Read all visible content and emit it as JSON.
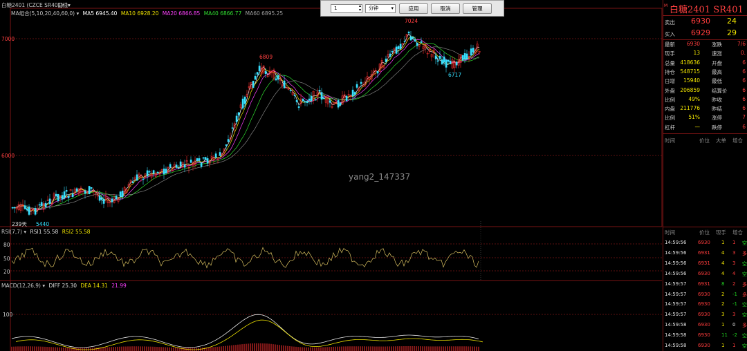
{
  "header": {
    "symbol_title": "白糖2401 (CZCE SR401)",
    "period": "日线",
    "ma_label": "MA组合(5,10,20,40,60,0)",
    "ma5": "MA5 6945.40",
    "ma10": "MA10 6928.20",
    "ma20": "MA20 6866.85",
    "ma40": "MA40 6866.77",
    "ma60": "MA60 6895.25"
  },
  "toolbar": {
    "count_value": "1",
    "unit_value": "分钟",
    "apply_label": "应用",
    "cancel_label": "取消",
    "manage_label": "管理"
  },
  "price_axis": {
    "p7000": "7000",
    "p6000": "6000"
  },
  "annotations": {
    "high_label": "7024",
    "peak_label": "6809",
    "low_label": "5440",
    "dip_label": "6717",
    "bottom_tag": "239天"
  },
  "watermark": "yang2_147337",
  "rsi": {
    "label": "RSI(7,7)",
    "rsi1": "RSI1 55.58",
    "rsi2": "RSI2 55.58",
    "ticks": [
      "80",
      "50",
      "20"
    ]
  },
  "macd": {
    "label": "MACD(12,26,9)",
    "diff": "DIFF 25.30",
    "dea": "DEA 14.31",
    "macd": "21.99",
    "tick": "100"
  },
  "quote": {
    "title": "白糖2401",
    "code": "SR401",
    "sell_label": "卖出",
    "sell_price": "6930",
    "sell_vol": "24",
    "buy_label": "买入",
    "buy_price": "6929",
    "buy_vol": "29",
    "rows": [
      {
        "l1": "最新",
        "v1": "6930",
        "c1": "red",
        "l2": "涨跌",
        "v2": "7/6"
      },
      {
        "l1": "现手",
        "v1": "13",
        "c1": "yel",
        "l2": "速涨",
        "v2": "0."
      },
      {
        "l1": "总量",
        "v1": "418636",
        "c1": "yel",
        "l2": "开盘",
        "v2": "6"
      },
      {
        "l1": "持仓",
        "v1": "548715",
        "c1": "yel",
        "l2": "最高",
        "v2": "6"
      },
      {
        "l1": "日增",
        "v1": "15940",
        "c1": "yel",
        "l2": "最低",
        "v2": "6"
      },
      {
        "l1": "外盘",
        "v1": "206859",
        "c1": "yel",
        "l2": "结算价",
        "v2": "6"
      },
      {
        "l1": "比例",
        "v1": "49%",
        "c1": "yel",
        "l2": "昨收",
        "v2": "6"
      },
      {
        "l1": "内盘",
        "v1": "211776",
        "c1": "yel",
        "l2": "昨结",
        "v2": "6"
      },
      {
        "l1": "比例",
        "v1": "51%",
        "c1": "yel",
        "l2": "涨停",
        "v2": "7"
      },
      {
        "l1": "杠杆",
        "v1": "—",
        "c1": "yel",
        "l2": "跌停",
        "v2": "6"
      }
    ],
    "col_headers": [
      "时间",
      "价位",
      "大单",
      "增仓"
    ]
  },
  "ticks": {
    "col_headers": [
      "时间",
      "价位",
      "现手",
      "增仓"
    ],
    "rows": [
      {
        "time": "14:59:56",
        "price": "6930",
        "vol": "1",
        "chg": "1",
        "dir": "空"
      },
      {
        "time": "14:59:56",
        "price": "6931",
        "vol": "4",
        "chg": "3",
        "dir": "多"
      },
      {
        "time": "14:59:56",
        "price": "6931",
        "vol": "4",
        "chg": "3",
        "dir": "空"
      },
      {
        "time": "14:59:56",
        "price": "6930",
        "vol": "4",
        "chg": "4",
        "dir": "空"
      },
      {
        "time": "14:59:57",
        "price": "6931",
        "vol": "8",
        "chg": "2",
        "dir": "多"
      },
      {
        "time": "14:59:57",
        "price": "6930",
        "vol": "2",
        "chg": "-1",
        "dir": "多"
      },
      {
        "time": "14:59:57",
        "price": "6930",
        "vol": "2",
        "chg": "-1",
        "dir": "空"
      },
      {
        "time": "14:59:57",
        "price": "6930",
        "vol": "3",
        "chg": "3",
        "dir": "空"
      },
      {
        "time": "14:59:58",
        "price": "6930",
        "vol": "1",
        "chg": "0",
        "dir": "多"
      },
      {
        "time": "14:59:58",
        "price": "6930",
        "vol": "11",
        "chg": "-2",
        "dir": "空"
      },
      {
        "time": "14:59:58",
        "price": "6930",
        "vol": "1",
        "chg": "1",
        "dir": "空"
      }
    ]
  },
  "colors": {
    "up": "#ff3030",
    "down": "#36e0ff",
    "ma5": "#ffffff",
    "ma10": "#f0e400",
    "ma20": "#ff40ff",
    "ma40": "#30e030",
    "ma60": "#808080",
    "grid": "#7a1414",
    "rsi": "#d8c060"
  }
}
